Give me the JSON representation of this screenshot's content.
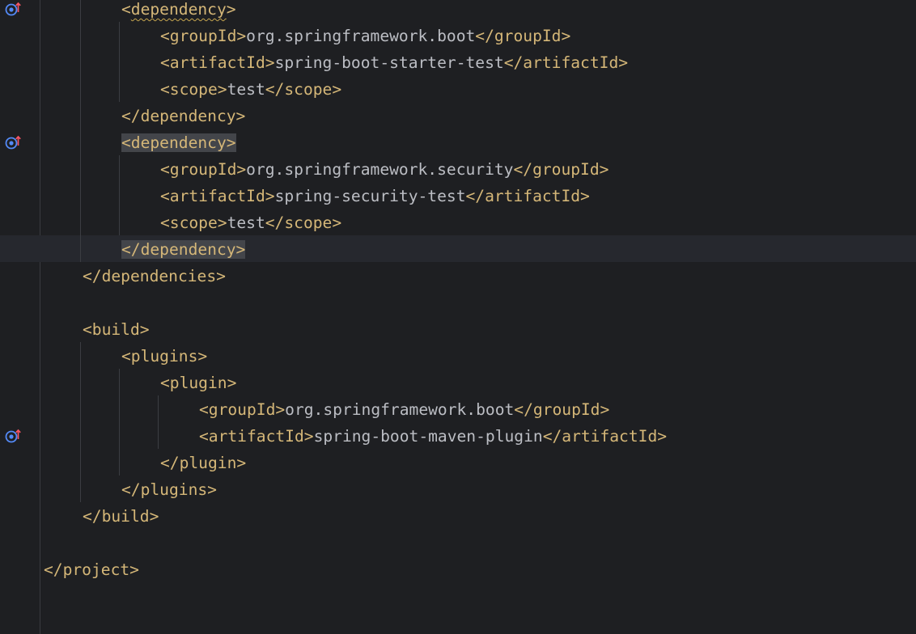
{
  "editor": {
    "lines": [
      {
        "indent": 2,
        "open": "<",
        "name": "dependency",
        "close": ">",
        "squiggle": true
      },
      {
        "indent": 3,
        "open": "<",
        "name": "groupId",
        "close": ">",
        "text": "org.springframework.boot",
        "end": "</groupId>"
      },
      {
        "indent": 3,
        "open": "<",
        "name": "artifactId",
        "close": ">",
        "text": "spring-boot-starter-test",
        "end": "</artifactId>"
      },
      {
        "indent": 3,
        "open": "<",
        "name": "scope",
        "close": ">",
        "text": "test",
        "end": "</scope>"
      },
      {
        "indent": 2,
        "full": "</dependency>"
      },
      {
        "indent": 2,
        "full": "<dependency>",
        "highlight": true
      },
      {
        "indent": 3,
        "open": "<",
        "name": "groupId",
        "close": ">",
        "text": "org.springframework.security",
        "end": "</groupId>"
      },
      {
        "indent": 3,
        "open": "<",
        "name": "artifactId",
        "close": ">",
        "text": "spring-security-test",
        "end": "</artifactId>"
      },
      {
        "indent": 3,
        "open": "<",
        "name": "scope",
        "close": ">",
        "text": "test",
        "end": "</scope>"
      },
      {
        "indent": 2,
        "full": "</dependency>",
        "highlight": true
      },
      {
        "indent": 1,
        "full": "</dependencies>"
      },
      {
        "indent": 0,
        "full": ""
      },
      {
        "indent": 1,
        "full": "<build>"
      },
      {
        "indent": 2,
        "full": "<plugins>"
      },
      {
        "indent": 3,
        "full": "<plugin>"
      },
      {
        "indent": 4,
        "open": "<",
        "name": "groupId",
        "close": ">",
        "text": "org.springframework.boot",
        "end": "</groupId>"
      },
      {
        "indent": 4,
        "open": "<",
        "name": "artifactId",
        "close": ">",
        "text": "spring-boot-maven-plugin",
        "end": "</artifactId>"
      },
      {
        "indent": 3,
        "full": "</plugin>"
      },
      {
        "indent": 2,
        "full": "</plugins>"
      },
      {
        "indent": 1,
        "full": "</build>"
      },
      {
        "indent": 0,
        "full": ""
      },
      {
        "indent": 0,
        "full": "</project>"
      }
    ],
    "gutter_icons": [
      {
        "line": 0,
        "icon": "maven-dependency-update-icon"
      },
      {
        "line": 5,
        "icon": "maven-dependency-update-icon"
      },
      {
        "line": 16,
        "icon": "maven-dependency-update-icon"
      }
    ],
    "colors": {
      "background": "#1e1f22",
      "tag": "#d5b778",
      "text": "#bcbec4",
      "caret_line": "#26282e",
      "tag_highlight": "#43454a"
    }
  }
}
